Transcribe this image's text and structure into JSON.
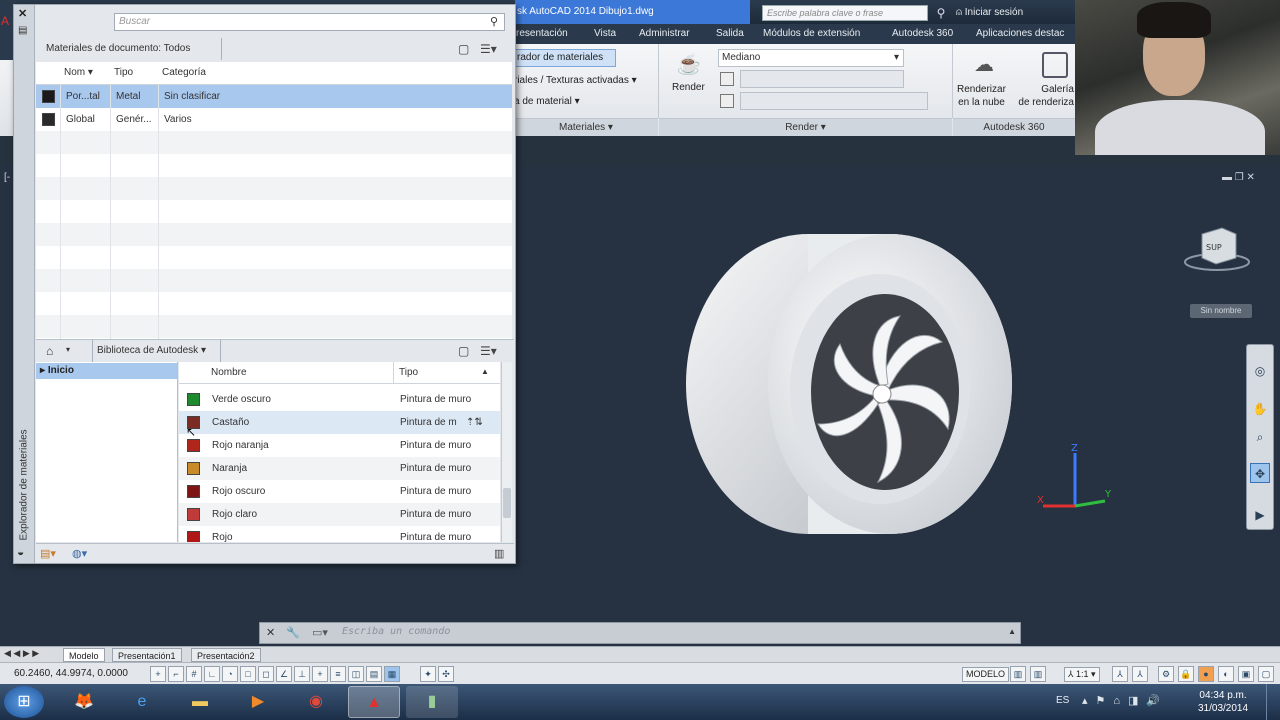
{
  "titlebar": {
    "title": "sk AutoCAD 2014  Dibujo1.dwg",
    "search_placeholder": "Escribe palabra clave o frase",
    "signin": "Iniciar sesión",
    "binoculars_icon": "binoculars-icon",
    "user_icon": "user-icon"
  },
  "ribbon_tabs": [
    "resentación",
    "Vista",
    "Administrar",
    "Salida",
    "Módulos de extensión",
    "Autodesk 360",
    "Aplicaciones destac"
  ],
  "ribbon": {
    "materials_browser_btn": "rador de materiales",
    "textures": "riales / Texturas activadas",
    "material_map": "a de material",
    "render_btn": "Render",
    "quality": "Mediano",
    "render_cloud_l1": "Renderizar",
    "render_cloud_l2": "en la nube",
    "gallery_l1": "Galería",
    "gallery_l2": "de renderiza",
    "panels": [
      "Materiales",
      "Render",
      "Autodesk 360"
    ]
  },
  "materials_browser": {
    "side_label": "Explorador de materiales",
    "search_placeholder": "Buscar",
    "doc_breadcrumb": "Materiales de documento: Todos",
    "doc_columns": [
      "Nom",
      "Tipo",
      "Categoría"
    ],
    "doc_rows": [
      {
        "name": "Por...tal",
        "type": "Metal",
        "category": "Sin clasificar",
        "selected": true
      },
      {
        "name": "Global",
        "type": "Genér...",
        "category": "Varios",
        "selected": false
      }
    ],
    "lib_breadcrumb": "Biblioteca de Autodesk",
    "tree": [
      "Inicio"
    ],
    "lib_columns": [
      "Nombre",
      "Tipo"
    ],
    "lib_rows": [
      {
        "name": "Verde oscuro",
        "type": "Pintura de muro",
        "color": "#1e8a2e"
      },
      {
        "name": "Castaño",
        "type": "Pintura de m",
        "color": "#7a2b22"
      },
      {
        "name": "Rojo naranja",
        "type": "Pintura de muro",
        "color": "#b0261c"
      },
      {
        "name": "Naranja",
        "type": "Pintura de muro",
        "color": "#c98a2a"
      },
      {
        "name": "Rojo oscuro",
        "type": "Pintura de muro",
        "color": "#7e1414"
      },
      {
        "name": "Rojo claro",
        "type": "Pintura de muro",
        "color": "#c03a3a"
      },
      {
        "name": "Rojo",
        "type": "Pintura de muro",
        "color": "#b01717"
      }
    ]
  },
  "viewport": {
    "label": "[-",
    "viewcube_label": "SUP",
    "wcs": "Sin nombre"
  },
  "commandline": {
    "placeholder": "Escriba un comando"
  },
  "layout_tabs": [
    "Modelo",
    "Presentación1",
    "Presentación2"
  ],
  "statusbar": {
    "coords": "60.2460, 44.9974, 0.0000",
    "model": "MODELO",
    "scale": "1:1"
  },
  "taskbar": {
    "lang": "ES",
    "time": "04:34 p.m.",
    "date": "31/03/2014"
  }
}
